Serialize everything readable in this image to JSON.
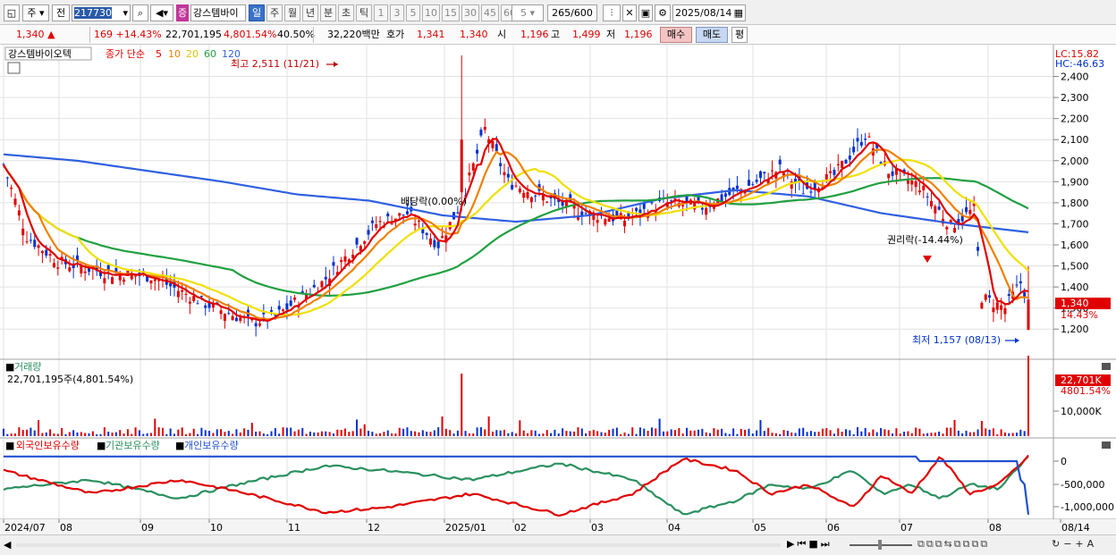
{
  "toolbar": {
    "market": "주",
    "prev_label": "전",
    "code": "217730",
    "stock_badge": "증",
    "stock_name": "강스템바이",
    "periods": [
      "일",
      "주",
      "월",
      "년",
      "분",
      "초",
      "틱"
    ],
    "active_period": "일",
    "intervals": [
      "1",
      "3",
      "5",
      "10",
      "15",
      "30",
      "45",
      "60"
    ],
    "interval_value": "5",
    "count": "265/600",
    "date": "2025/08/14"
  },
  "quote": {
    "price": "1,340",
    "change": "169 +14.43%",
    "volume": "22,701,195",
    "volume_ratio": "4,801.54%",
    "turnover": "40.50%",
    "amount": "32,220백만",
    "ask_label": "호가",
    "ask1": "1,341",
    "bid1": "1,340",
    "open_label": "시",
    "open": "1,196",
    "high_label": "고",
    "high": "1,499",
    "low_label": "저",
    "low": "1,196",
    "buy_btn": "매수",
    "sell_btn": "매도",
    "eval_btn": "평"
  },
  "price_panel": {
    "stock_label": "강스템바이오텍",
    "ma_label": "종가 단순",
    "ma_periods": [
      "5",
      "10",
      "20",
      "60",
      "120"
    ],
    "lc": "LC:15.82",
    "hc": "HC:-46.63",
    "high_note": "최고 2,511 (11/21)",
    "low_note": "최저 1,157 (08/13)",
    "rights_note": "권리락(-14.44%)",
    "dividend_note": "배당락(0.00%)",
    "y_ticks": [
      "2,400",
      "2,300",
      "2,200",
      "2,100",
      "2,000",
      "1,900",
      "1,800",
      "1,700",
      "1,600",
      "1,500",
      "1,400",
      "1,300",
      "1,200"
    ],
    "current_price_tag": "1,340",
    "current_pct_tag": "14.43%"
  },
  "volume_panel": {
    "title": "거래량",
    "value": "22,701,195주(4,801.54%)",
    "tag_value": "22,701K",
    "tag_pct": "4801.54%",
    "y_tick": "10,000K"
  },
  "holdings_panel": {
    "legend": [
      "외국인보유수량",
      "기관보유수량",
      "개인보유수량"
    ],
    "y_ticks": [
      "0",
      "-500,000",
      "-1,000,000"
    ]
  },
  "x_axis": [
    "2024/07",
    "08",
    "09",
    "10",
    "11",
    "12",
    "2025/01",
    "02",
    "03",
    "04",
    "05",
    "06",
    "07",
    "08",
    "08/14"
  ],
  "colors": {
    "ma5": "#e00000",
    "ma10": "#f08000",
    "ma20": "#f0e000",
    "ma60": "#20a040",
    "ma120": "#3060e0",
    "up": "#e00000",
    "down": "#0030d0",
    "foreign": "#e00000",
    "institution": "#2a9060",
    "individual": "#2050d0"
  },
  "chart_data": {
    "type": "candlestick",
    "x": [
      "2024/07",
      "2024/08",
      "2024/09",
      "2024/10",
      "2024/11",
      "2024/12",
      "2025/01",
      "2025/02",
      "2025/03",
      "2025/04",
      "2025/05",
      "2025/06",
      "2025/07",
      "2025/08",
      "2025/08/14"
    ],
    "close": [
      1900,
      1480,
      1280,
      1420,
      1700,
      2150,
      1850,
      1750,
      1800,
      1950,
      2050,
      1660,
      1300,
      1360,
      1340
    ],
    "ma120": [
      2030,
      2000,
      1950,
      1900,
      1840,
      1810,
      1740,
      1710,
      1740,
      1820,
      1860,
      1830,
      1750,
      1700,
      1660
    ],
    "ylim": [
      1150,
      2500
    ]
  }
}
